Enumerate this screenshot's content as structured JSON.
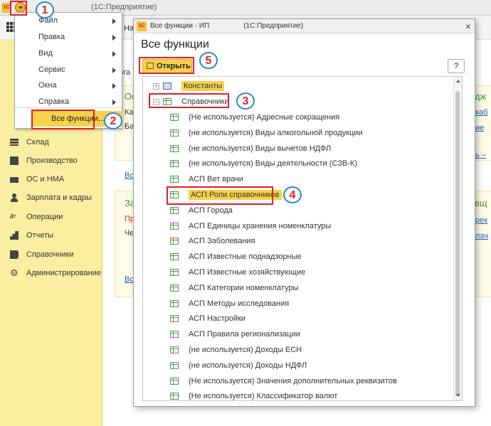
{
  "app": {
    "logo": "1С",
    "title": "(1С:Предприятие)"
  },
  "main_fragments": {
    "tab_fragment": "Нач",
    "prog_fragment": "рога",
    "green1": "Ос",
    "green1_right": "дж",
    "ka": "Ка",
    "ba": "Ба",
    "link1": "Вс",
    "link_kab": "каб",
    "link_ie": "ие",
    "link_dash": "ь –",
    "green2": "За",
    "green2_right": "вщ",
    "red_pr": "Пр",
    "che": "Че",
    "link_rek": "рек",
    "link_lach": "лач",
    "link2": "Вс"
  },
  "sidebar": {
    "items": [
      {
        "label": "Склад",
        "icon": "warehouse-icon"
      },
      {
        "label": "Производство",
        "icon": "production-icon"
      },
      {
        "label": "ОС и НМА",
        "icon": "assets-icon"
      },
      {
        "label": "Зарплата и кадры",
        "icon": "person-icon"
      },
      {
        "label": "Операции",
        "icon": "operations-icon"
      },
      {
        "label": "Отчеты",
        "icon": "chart-icon"
      },
      {
        "label": "Справочники",
        "icon": "book-icon"
      },
      {
        "label": "Администрирование",
        "icon": "gear-icon"
      }
    ]
  },
  "menu": {
    "items": [
      {
        "label": "Файл"
      },
      {
        "label": "Правка"
      },
      {
        "label": "Вид"
      },
      {
        "label": "Сервис"
      },
      {
        "label": "Окна"
      },
      {
        "label": "Справка"
      }
    ],
    "all_functions": "Все функции..."
  },
  "dialog": {
    "title": "Все функции - ИП",
    "app_title": "(1С:Предприятие)",
    "heading": "Все функции",
    "open_button": "Открыть",
    "help_button": "?",
    "close_glyph": "×",
    "tree": {
      "constants": "Константы",
      "catalogs": "Справочники",
      "items": [
        "(Не используется) Адресные сокращения",
        "(не используется) Виды алкогольной продукции",
        "(не используется) Виды вычетов НДФЛ",
        "(не используется) Виды деятельности (СЗВ-К)",
        "АСП Вет врачи",
        "АСП Роли справочников",
        "АСП Города",
        "АСП Единицы хранения номенклатуры",
        "АСП Заболевания",
        "АСП Известные поднадзорные",
        "АСП Известные хозяйствующие",
        "АСП Категории номенклатуры",
        "АСП Методы исследования",
        "АСП Настройки",
        "АСП Правила регионализации",
        "(не используется) Доходы ЕСН",
        "(не используется) Доходы НДФЛ",
        "(Не используется) Значения дополнительных реквизитов",
        "(Не используется) Классификатор валют"
      ]
    }
  },
  "annotations": [
    "1",
    "2",
    "3",
    "4",
    "5"
  ],
  "colors": {
    "accent": "#f7d24a",
    "sidebar": "#faeea0",
    "annotation_box": "#e0202a",
    "annotation_circle": "#2a86d8"
  }
}
